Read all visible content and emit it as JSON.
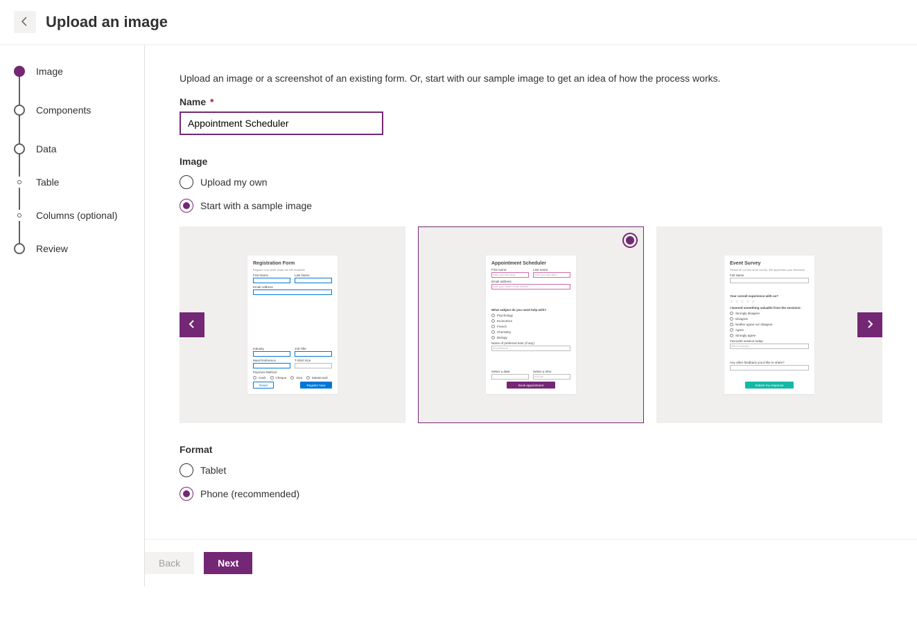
{
  "header": {
    "title": "Upload an image"
  },
  "steps": [
    {
      "label": "Image",
      "active": true,
      "small": false
    },
    {
      "label": "Components",
      "active": false,
      "small": false
    },
    {
      "label": "Data",
      "active": false,
      "small": false
    },
    {
      "label": "Table",
      "active": false,
      "small": true
    },
    {
      "label": "Columns (optional)",
      "active": false,
      "small": true
    },
    {
      "label": "Review",
      "active": false,
      "small": false
    }
  ],
  "main": {
    "intro": "Upload an image or a screenshot of an existing form. Or, start with our sample image to get an idea of how the process works.",
    "name_label": "Name",
    "name_required": "*",
    "name_value": "Appointment Scheduler",
    "image_label": "Image",
    "image_options": [
      {
        "label": "Upload my own",
        "selected": false
      },
      {
        "label": "Start with a sample image",
        "selected": true
      }
    ],
    "samples": [
      {
        "selected": false,
        "title": "Registration Form",
        "subtitle": "Register now while seats are still available",
        "rows": [
          {
            "type": "pair",
            "a": "First Name",
            "b": "Last Name",
            "style": "blue"
          },
          {
            "type": "single",
            "a": "Email Address",
            "style": "blue"
          },
          {
            "type": "pair",
            "a": "Industry",
            "b": "Job Title",
            "style_a": "select",
            "style_b": "blue"
          },
          {
            "type": "pair",
            "a": "Meal Preference",
            "b": "T-Shirt Size",
            "style_a": "select",
            "style_b": "plain"
          },
          {
            "type": "radios",
            "label": "Payment Method",
            "opts": [
              "Cash",
              "Cheque",
              "Visa",
              "Mastercard"
            ]
          }
        ],
        "buttons": {
          "reset": "Reset",
          "primary": "Register Now",
          "style": "blue"
        }
      },
      {
        "selected": true,
        "title": "Appointment Scheduler",
        "rows": [
          {
            "type": "pair",
            "a": "First name:",
            "b": "Last name:",
            "ph_a": "Enter your first name",
            "ph_b": "Enter your last name",
            "style": "pink"
          },
          {
            "type": "single",
            "a": "Email address:",
            "ph_a": "Enter your student email address",
            "style": "pink"
          },
          {
            "type": "radios-v",
            "label": "What subject do you need help with?",
            "opts": [
              "Psychology",
              "Economics",
              "French",
              "Chemistry",
              "Biology"
            ]
          },
          {
            "type": "single",
            "a": "Name of preferred tutor (if any):",
            "ph_a": "No preference",
            "style": "plain"
          },
          {
            "type": "pair",
            "a": "Select a date:",
            "b": "Select a time:",
            "style": "plain",
            "icon_a": "calendar",
            "ph_b": "9:00 AM"
          }
        ],
        "buttons": {
          "primary": "Book appointment",
          "style": "purple"
        }
      },
      {
        "selected": false,
        "title": "Event Survey",
        "subtitle": "Please fill out this short survey. We appreciate your feedback.",
        "rows": [
          {
            "type": "single",
            "a": "Full Name",
            "style": "plain"
          },
          {
            "type": "stars",
            "a": "Your overall experience with us?"
          },
          {
            "type": "radios-v",
            "label": "I learned something valuable from the sessions:",
            "opts": [
              "Strongly disagree",
              "Disagree",
              "Neither agree nor disagree",
              "Agree",
              "Strongly agree"
            ]
          },
          {
            "type": "single",
            "a": "Favourite session today:",
            "ph_a": "Select a session",
            "style": "select-plain"
          },
          {
            "type": "single",
            "a": "Any other feedback you'd like to share?",
            "style": "plain"
          }
        ],
        "buttons": {
          "primary": "Submit my response",
          "style": "teal"
        }
      }
    ],
    "format_label": "Format",
    "format_options": [
      {
        "label": "Tablet",
        "selected": false
      },
      {
        "label": "Phone (recommended)",
        "selected": true
      }
    ]
  },
  "footer": {
    "back": "Back",
    "next": "Next"
  }
}
